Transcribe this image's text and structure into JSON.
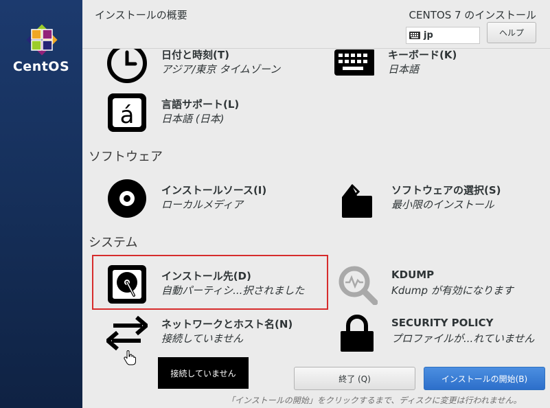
{
  "brand": {
    "name": "CentOS"
  },
  "header": {
    "title": "インストールの概要",
    "product": "CENTOS 7 のインストール",
    "keyboard_layout": "jp",
    "help_label": "ヘルプ"
  },
  "sections": {
    "software": "ソフトウェア",
    "system": "システム"
  },
  "spokes": {
    "datetime": {
      "title": "日付と時刻(T)",
      "status": "アジア/東京 タイムゾーン"
    },
    "keyboard": {
      "title": "キーボード(K)",
      "status": "日本語"
    },
    "language": {
      "title": "言語サポート(L)",
      "status": "日本語 (日本)"
    },
    "source": {
      "title": "インストールソース(I)",
      "status": "ローカルメディア"
    },
    "software_selection": {
      "title": "ソフトウェアの選択(S)",
      "status": "最小限のインストール"
    },
    "destination": {
      "title": "インストール先(D)",
      "status": "自動パーティシ...択されました"
    },
    "kdump": {
      "title": "KDUMP",
      "status": "Kdump が有効になります"
    },
    "network": {
      "title": "ネットワークとホスト名(N)",
      "status": "接続していません"
    },
    "security": {
      "title": "SECURITY POLICY",
      "status": "プロファイルが...れていません"
    }
  },
  "tooltip": "接続していません",
  "buttons": {
    "quit": "終了 (Q)",
    "begin": "インストールの開始(B)"
  },
  "footer_note": "「インストールの開始」をクリックするまで、ディスクに変更は行われません。",
  "colors": {
    "sidebar": "#1c3a6e",
    "primary_button": "#3a7fd6",
    "highlight": "#d62b2b"
  }
}
